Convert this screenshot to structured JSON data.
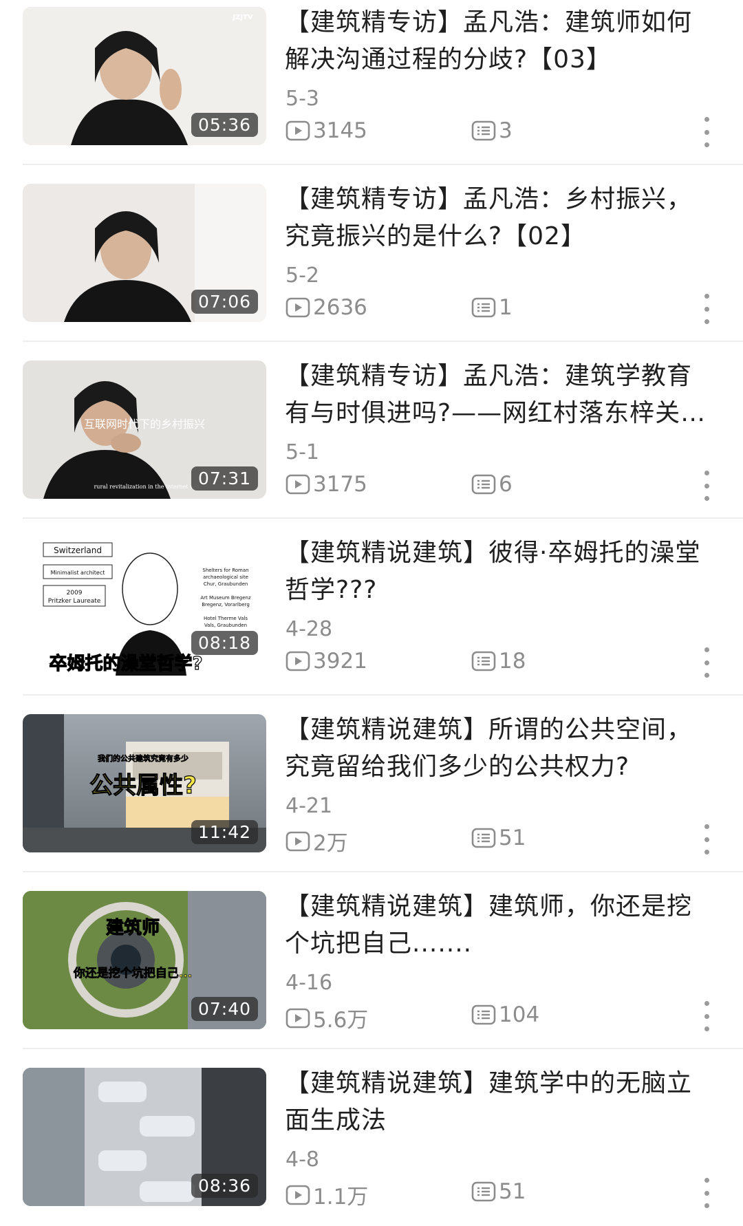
{
  "videos": [
    {
      "title": "【建筑精专访】孟凡浩：建筑师如何解决沟通过程的分歧?【03】",
      "date": "5-3",
      "views": "3145",
      "comments": "3",
      "duration": "05:36",
      "thumb_text": "JZJTV"
    },
    {
      "title": "【建筑精专访】孟凡浩：乡村振兴，究竟振兴的是什么?【02】",
      "date": "5-2",
      "views": "2636",
      "comments": "1",
      "duration": "07:06"
    },
    {
      "title": "【建筑精专访】孟凡浩：建筑学教育有与时俱进吗?——网红村落东梓关…",
      "date": "5-1",
      "views": "3175",
      "comments": "6",
      "duration": "07:31",
      "thumb_text": "互联网时代下的乡村振兴",
      "thumb_sub": "rural revitalization in the internet era"
    },
    {
      "title": "【建筑精说建筑】彼得·卒姆托的澡堂哲学???",
      "date": "4-28",
      "views": "3921",
      "comments": "18",
      "duration": "08:18",
      "thumb_labels": [
        "Switzerland",
        "Minimalist architect",
        "2009",
        "Pritzker Laureate"
      ],
      "thumb_notes": [
        "Shelters for Roman",
        "archaeological site",
        "Chur, Graubunden",
        "Art Museum Bregenz",
        "Bregenz, Vorarlberg",
        "Hotel Therme Vals",
        "Vals, Graubunden"
      ],
      "thumb_caption": "卒姆托的澡堂哲学?"
    },
    {
      "title": "【建筑精说建筑】所谓的公共空间，究竟留给我们多少的公共权力?",
      "date": "4-21",
      "views": "2万",
      "comments": "51",
      "duration": "11:42",
      "thumb_small": "我们的公共建筑究竟有多少",
      "thumb_big": "公共属性?"
    },
    {
      "title": "【建筑精说建筑】建筑师，你还是挖个坑把自己.......",
      "date": "4-16",
      "views": "5.6万",
      "comments": "104",
      "duration": "07:40",
      "thumb_big": "建筑师",
      "thumb_small": "你还是挖个坑把自己..."
    },
    {
      "title": "【建筑精说建筑】建筑学中的无脑立面生成法",
      "date": "4-8",
      "views": "1.1万",
      "comments": "51",
      "duration": "08:36"
    }
  ],
  "icons": {
    "views": "play-box-icon",
    "comments": "comment-list-icon",
    "more": "more-vertical-icon"
  },
  "colors": {
    "text": "#1f1f1f",
    "meta": "#8c8c8c",
    "divider": "#eeeeee",
    "yellow": "#f2e44a"
  }
}
